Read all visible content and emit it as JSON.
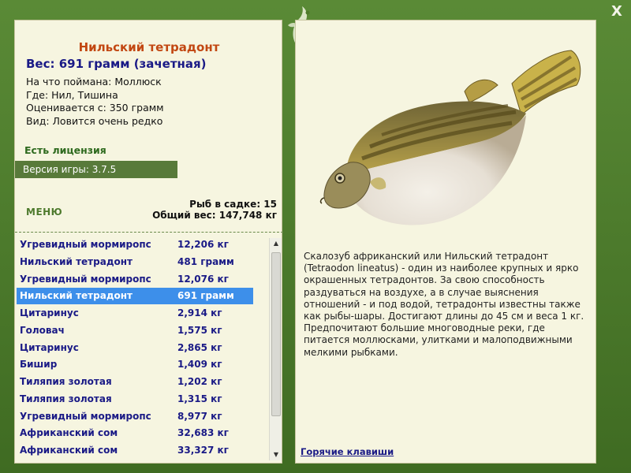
{
  "window": {
    "close_label": "X"
  },
  "fish": {
    "name": "Нильский тетрадонт",
    "weight": "Вес: 691 грамм (зачетная)",
    "caught_with": "На что поймана: Моллюск",
    "location": "Где: Нил, Тишина",
    "valued_from": "Оценивается с: 350 грамм",
    "rarity": "Вид: Ловится очень редко",
    "description": "Скалозуб африканский или Нильский тетрадонт (Tetraodon lineatus) - один из наиболее крупных и ярко окрашенных тетрадонтов. За свою способность раздуваться на воздухе, а в случае выяснения отношений - и под водой, тетрадонты известны также как рыбы-шары. Достигают длины до 45 см и веса 1 кг. Предпочитают большие многоводные реки, где питается моллюсками, улитками и малоподвижными мелкими рыбками."
  },
  "license": {
    "label": "Есть лицензия"
  },
  "version": {
    "label": "Версия игры: 3.7.5"
  },
  "menu": {
    "label": "МЕНЮ"
  },
  "cage": {
    "count_label": "Рыб в садке: 15",
    "total_weight_label": "Общий вес: 147,748 кг"
  },
  "catch_list": {
    "selected_index": 3,
    "items": [
      {
        "name": "Угревидный мормиропс",
        "weight": "12,206 кг"
      },
      {
        "name": "Нильский тетрадонт",
        "weight": "481 грамм"
      },
      {
        "name": "Угревидный мормиропс",
        "weight": "12,076 кг"
      },
      {
        "name": "Нильский тетрадонт",
        "weight": "691 грамм"
      },
      {
        "name": "Цитаринус",
        "weight": "2,914 кг"
      },
      {
        "name": "Головач",
        "weight": "1,575 кг"
      },
      {
        "name": "Цитаринус",
        "weight": "2,865 кг"
      },
      {
        "name": "Бишир",
        "weight": "1,409 кг"
      },
      {
        "name": "Тиляпия золотая",
        "weight": "1,202 кг"
      },
      {
        "name": "Тиляпия золотая",
        "weight": "1,315 кг"
      },
      {
        "name": "Угревидный мормиропс",
        "weight": "8,977 кг"
      },
      {
        "name": "Африканский сом",
        "weight": "32,683 кг"
      },
      {
        "name": "Африканский сом",
        "weight": "33,327 кг"
      }
    ]
  },
  "hotkeys": {
    "label": "Горячие клавиши"
  },
  "icons": {
    "close": "close-icon",
    "logo": "fish-logo-icon",
    "scroll_up": "arrow-up-icon",
    "scroll_down": "arrow-down-icon"
  },
  "colors": {
    "frame": "#4e7a2c",
    "panel": "#f6f5e0",
    "selection": "#3d8fea",
    "title": "#c24712",
    "list_text": "#1a1a86"
  }
}
